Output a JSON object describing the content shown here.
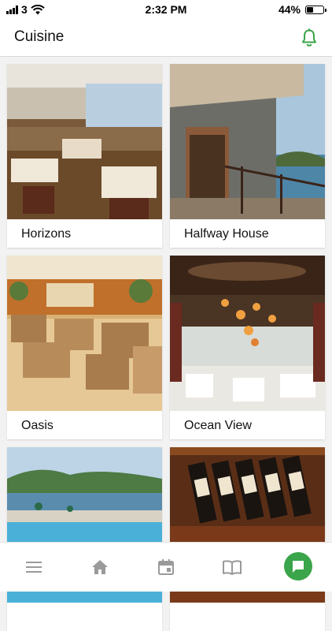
{
  "status_bar": {
    "carrier": "3",
    "time": "2:32 PM",
    "battery": "44%",
    "battery_level": 0.44
  },
  "header": {
    "title": "Cuisine",
    "bell_icon": "bell-icon",
    "accent_color": "#3aa54a"
  },
  "restaurants": [
    {
      "name": "Horizons"
    },
    {
      "name": "Halfway House"
    },
    {
      "name": "Oasis"
    },
    {
      "name": "Ocean View"
    },
    {
      "name": ""
    },
    {
      "name": ""
    }
  ],
  "tab_bar": {
    "icons": [
      "menu-icon",
      "home-icon",
      "calendar-icon",
      "book-icon",
      "chat-icon"
    ],
    "active_color": "#3aa54a"
  }
}
